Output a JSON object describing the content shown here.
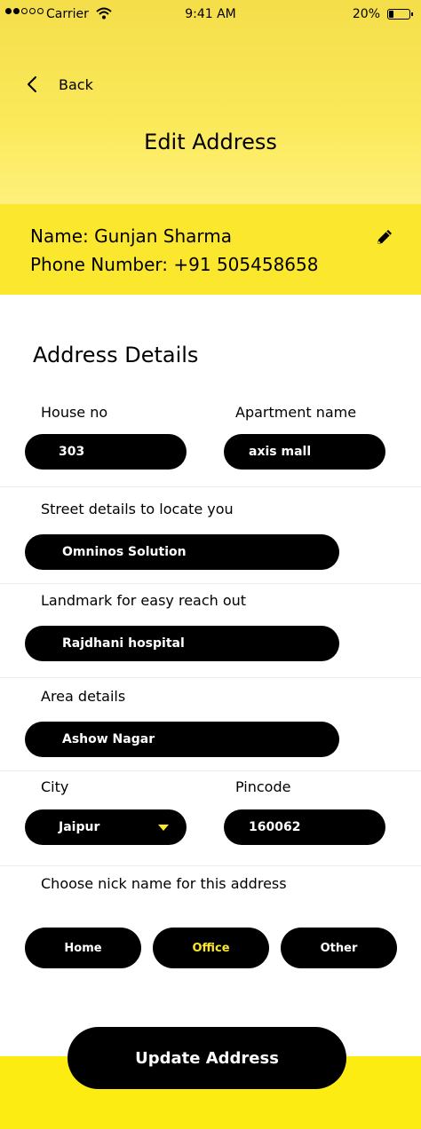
{
  "status_bar": {
    "carrier": "Carrier",
    "time": "9:41 AM",
    "battery": "20%"
  },
  "header": {
    "back_label": "Back",
    "title": "Edit Address"
  },
  "profile": {
    "name": "Name: Gunjan Sharma",
    "phone": "Phone Number: +91 505458658"
  },
  "section_title": "Address Details",
  "fields": {
    "house_no": {
      "label": "House no",
      "value": "303"
    },
    "apartment": {
      "label": "Apartment name",
      "value": "axis mall"
    },
    "street": {
      "label": "Street details to locate you",
      "value": "Omninos Solution"
    },
    "landmark": {
      "label": "Landmark for easy reach out",
      "value": "Rajdhani hospital"
    },
    "area": {
      "label": "Area details",
      "value": "Ashow Nagar"
    },
    "city": {
      "label": "City",
      "value": "Jaipur"
    },
    "pincode": {
      "label": "Pincode",
      "value": "160062"
    }
  },
  "nickname": {
    "label": "Choose nick name for this address",
    "options": [
      "Home",
      "Office",
      "Other"
    ],
    "selected": "Office"
  },
  "update_button": "Update Address",
  "colors": {
    "accent_yellow": "#fbe72d",
    "header_yellow": "#f4de4a",
    "black": "#000000"
  },
  "icons": [
    "back-chevron-icon",
    "edit-pencil-icon",
    "dropdown-caret-icon",
    "wifi-icon",
    "battery-icon"
  ]
}
